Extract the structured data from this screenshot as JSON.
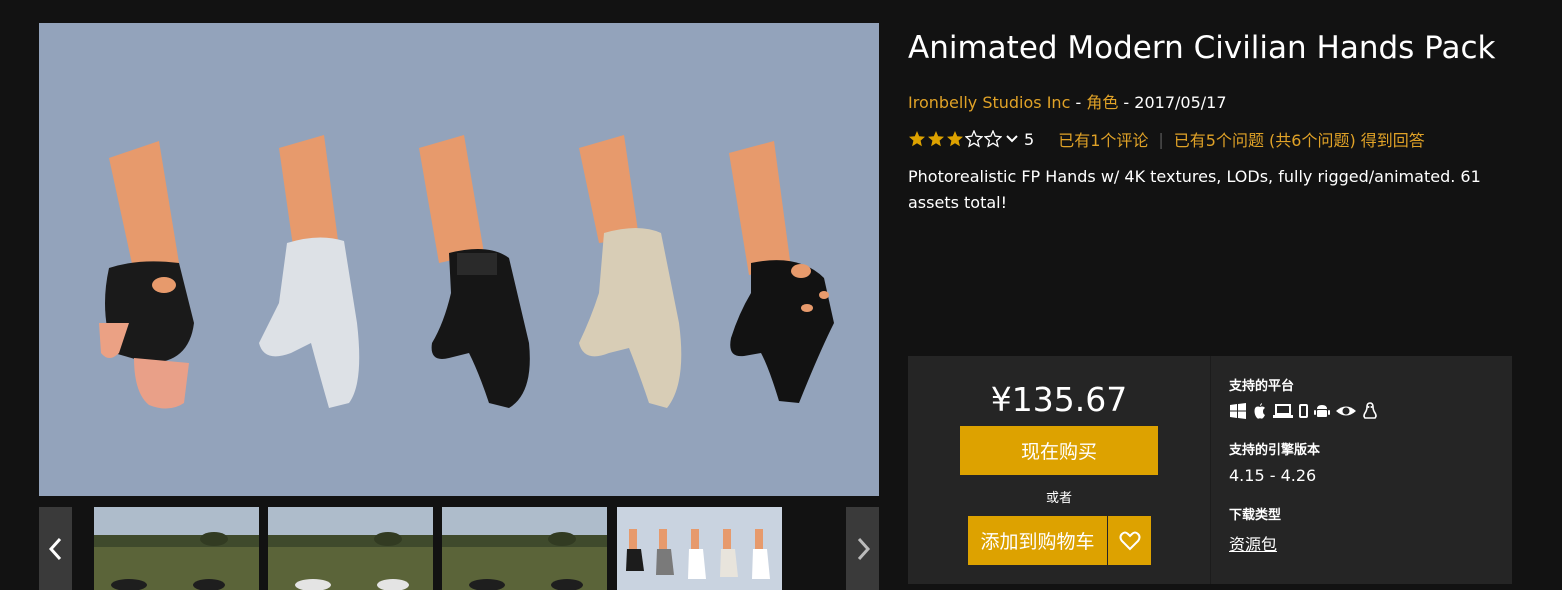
{
  "product": {
    "title": "Animated Modern Civilian Hands Pack",
    "seller": "Ironbelly Studios Inc",
    "separator1": " - ",
    "category": "角色",
    "separator2": " - ",
    "date": "2017/05/17"
  },
  "rating": {
    "stars_filled": 3,
    "stars_total": 5,
    "count": "5",
    "reviews_link": "已有1个评论",
    "questions_link": "已有5个问题 (共6个问题) 得到回答"
  },
  "description": "Photorealistic FP Hands w/ 4K textures, LODs, fully rigged/animated. 61 assets total!",
  "purchase": {
    "price": "¥135.67",
    "buy_now_label": "现在购买",
    "or_label": "或者",
    "add_to_cart_label": "添加到购物车"
  },
  "specs": {
    "platforms_label": "支持的平台",
    "platforms": [
      "windows-icon",
      "apple-icon",
      "laptop-icon",
      "mobile-icon",
      "android-icon",
      "eye-vr-icon",
      "linux-icon"
    ],
    "engine_label": "支持的引擎版本",
    "engine_value": "4.15 - 4.26",
    "download_label": "下载类型",
    "download_value": "资源包"
  },
  "gallery": {
    "main_image": "five-gloved-hands-image",
    "thumbnails": [
      "field-hands-thumbnail",
      "field-hands-thumbnail",
      "field-hands-thumbnail",
      "gloves-lineup-thumbnail"
    ],
    "active_thumbnail": 4
  },
  "colors": {
    "accent": "#dda200",
    "link": "#e0a227",
    "background": "#121212",
    "panel": "#252525",
    "image_background": "#93a3bb"
  }
}
